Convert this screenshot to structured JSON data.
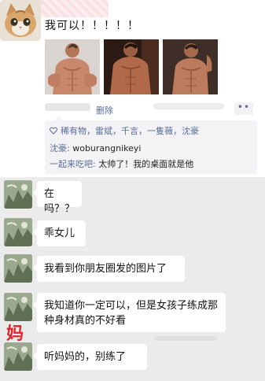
{
  "post": {
    "text": "我可以！！！！！",
    "delete_label": "删除",
    "more_label": "••",
    "likes": "稀有物，雷斌，千言，一隻薇，沈豪",
    "comments": [
      {
        "name": "沈豪:",
        "text": " woburangnikeyi"
      },
      {
        "name": "一起来吃吧:",
        "text": " 太帅了！我的桌面就是他"
      }
    ]
  },
  "chat": {
    "messages": [
      {
        "text": "在吗？？"
      },
      {
        "text": "乖女儿"
      },
      {
        "text": "我看到你朋友圈发的图片了"
      },
      {
        "text": "我知道你一定可以，但是女孩子练成那种身材真的不好看"
      },
      {
        "text": "听妈妈的，别练了"
      }
    ],
    "mom_label": "妈"
  },
  "colors": {
    "link": "#576b95",
    "chat_bg": "#ebebeb",
    "mom_label": "#e0242c"
  }
}
